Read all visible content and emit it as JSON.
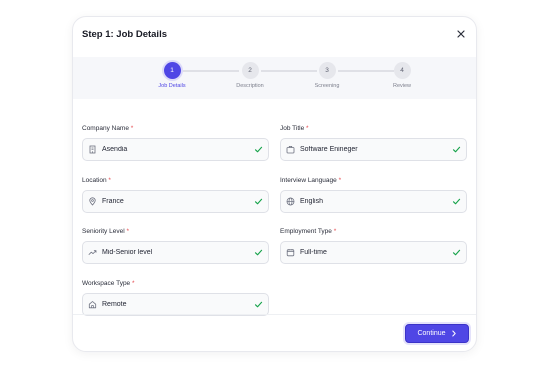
{
  "modal": {
    "title": "Step 1: Job Details",
    "close_icon": "close-icon"
  },
  "stepper": {
    "active_step": 1,
    "steps": [
      {
        "number": "1",
        "label": "Job Details"
      },
      {
        "number": "2",
        "label": "Description"
      },
      {
        "number": "3",
        "label": "Screening"
      },
      {
        "number": "4",
        "label": "Review"
      }
    ]
  },
  "form": {
    "company_name": {
      "label": "Company Name",
      "value": "Asendia",
      "icon": "building-icon"
    },
    "job_title": {
      "label": "Job Title",
      "value": "Software Enineger",
      "icon": "briefcase-icon"
    },
    "location": {
      "label": "Location",
      "value": "France",
      "icon": "map-pin-icon"
    },
    "interview_language": {
      "label": "Interview Language",
      "value": "English",
      "icon": "globe-icon"
    },
    "seniority_level": {
      "label": "Seniority Level",
      "value": "Mid-Senior level",
      "icon": "trending-up-icon"
    },
    "employment_type": {
      "label": "Employment Type",
      "value": "Full-time",
      "icon": "calendar-icon"
    },
    "workspace_type": {
      "label": "Workspace Type",
      "value": "Remote",
      "icon": "home-icon"
    },
    "required_marker": "*"
  },
  "footer": {
    "continue_label": "Continue",
    "continue_icon": "chevron-right-icon"
  },
  "colors": {
    "accent": "#4f46e5",
    "check": "#16a34a",
    "required": "#e5484d"
  }
}
